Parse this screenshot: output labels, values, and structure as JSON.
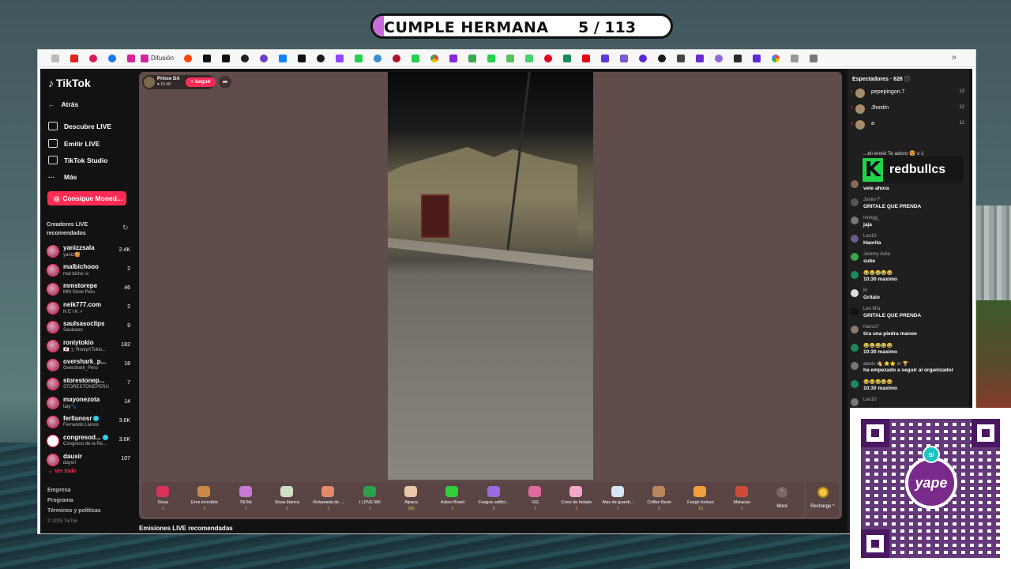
{
  "overlay": {
    "title": "CUMPLE HERMANA",
    "counter": "5 / 113",
    "redbull_text": "redbullcs",
    "redbull_logo": "K",
    "yape_text": "yape",
    "yape_badge": "S/"
  },
  "bookmarks": {
    "difusion_label": "Difusión",
    "more": "»"
  },
  "sidebar": {
    "logo": "TikTok",
    "back": "Atrás",
    "nav": [
      "Descubre LIVE",
      "Emitir LIVE",
      "TikTok Studio",
      "Más"
    ],
    "coins_button": "Consigue Moned...",
    "section_title": "Creadores LIVE recomendados",
    "creators": [
      {
        "name": "yanizzsala",
        "sub": "yaniz🥰",
        "count": "2.4K"
      },
      {
        "name": "malbichooo",
        "sub": "mal bicho ☠",
        "count": "2"
      },
      {
        "name": "mmstorepe",
        "sub": "MM Store Peru",
        "count": "46"
      },
      {
        "name": "neik777.com",
        "sub": "N E I K ✓",
        "count": "2"
      },
      {
        "name": "saulsasoclips",
        "sub": "Saulsaso",
        "count": "9"
      },
      {
        "name": "roniytokio",
        "sub": "🇯🇵 🇮 RoniyXTokio...",
        "count": "182"
      },
      {
        "name": "overshark_p...",
        "sub": "Overshark_Peru",
        "count": "18"
      },
      {
        "name": "storestonep...",
        "sub": "STORESTONEPERU",
        "count": "7"
      },
      {
        "name": "mayonezota",
        "sub": "taty🐾",
        "count": "14"
      },
      {
        "name": "ferllanosr",
        "sub": "Fernando Llanos",
        "count": "3.6K"
      },
      {
        "name": "congresod...",
        "sub": "Congreso de la Re...",
        "count": "3.6K"
      },
      {
        "name": "dausir",
        "sub": "daysri",
        "count": "107"
      }
    ],
    "see_all": "Ver todo",
    "footer": [
      "Empresa",
      "Programa",
      "Términos y políticas"
    ],
    "copyright": "© 2025 TikTok"
  },
  "stream": {
    "host_name": "Prince DA",
    "host_likes": "♥ 15.4K",
    "follow": "+ Seguir",
    "share_icon": "➦",
    "recommended": "Emisiones LIVE recomendadas"
  },
  "gifts": [
    {
      "name": "Rosa",
      "price": "1",
      "color": "#d8325a"
    },
    {
      "name": "Eres increíble",
      "price": "1",
      "color": "#c98a4a"
    },
    {
      "name": "TikTok",
      "price": "1",
      "color": "#c77ad8"
    },
    {
      "name": "Rosa blanca",
      "price": "1",
      "color": "#cfe0c2"
    },
    {
      "name": "Rebanada de ...",
      "price": "1",
      "color": "#e28a6a"
    },
    {
      "name": "I LOVE MX",
      "price": "1",
      "color": "#2aa04a"
    },
    {
      "name": "Alpaca",
      "price": "299",
      "color": "#e8c8a8"
    },
    {
      "name": "Adoro Brasil",
      "price": "1",
      "color": "#2ed03a"
    },
    {
      "name": "Fuegos artifici...",
      "price": "5",
      "color": "#9a6ae0"
    },
    {
      "name": "GG",
      "price": "1",
      "color": "#e06aa0"
    },
    {
      "name": "Cono de helado",
      "price": "1",
      "color": "#f2a6c8"
    },
    {
      "name": "Alas de guardi...",
      "price": "1",
      "color": "#d6e6f2"
    },
    {
      "name": "Coffee Bean",
      "price": "5",
      "color": "#b8865a"
    },
    {
      "name": "Fuego furioso",
      "price": "10",
      "color": "#f0a03a"
    },
    {
      "name": "Maracas",
      "price": "1",
      "color": "#d04a3a"
    }
  ],
  "gift_more": "More",
  "recharge": "Recharge",
  "chat": {
    "spectators_label": "Espectadores · 626",
    "spectators": [
      {
        "rank": "1",
        "name": "pepepingon.7",
        "score": "13"
      },
      {
        "rank": "2",
        "name": "Jhostin",
        "score": "12"
      },
      {
        "rank": "3",
        "name": "a",
        "score": "11"
      }
    ],
    "gift_message": "...eli envió Te adoro 😍 x 1",
    "messages": [
      {
        "user": "Jhose Si",
        "text": "vete ahora"
      },
      {
        "user": "Junior F",
        "text": "GRITALE QUE PRENDA"
      },
      {
        "user": "Irvingg_",
        "text": "jaja"
      },
      {
        "user": "Leo10",
        "text": "Haorita"
      },
      {
        "user": "Jeremy Avila",
        "text": "sube"
      },
      {
        "user": "😂😂😂😂😂",
        "text": "10:30 maximo"
      },
      {
        "user": "M",
        "text": "Gritalo"
      },
      {
        "user": "Leo M'a",
        "text": "GRITALE QUE PRENDA"
      },
      {
        "user": "franco7",
        "text": "tira una piedra manoo"
      },
      {
        "user": "😂😂😂😂😂",
        "text": "10:30 maximo"
      },
      {
        "user": "alexis 🐴 ⭐⭐ er 🏆",
        "text": "ha empezado a seguir al organizador"
      },
      {
        "user": "😂😂😂😂😂",
        "text": "10:30 maximo"
      },
      {
        "user": "Leo10",
        "text": ""
      }
    ]
  }
}
